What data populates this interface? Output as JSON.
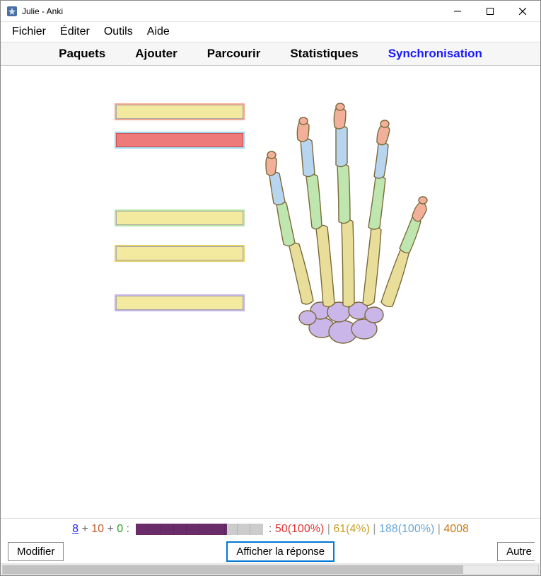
{
  "window": {
    "title": "Julie - Anki"
  },
  "menubar": {
    "items": [
      "Fichier",
      "Éditer",
      "Outils",
      "Aide"
    ]
  },
  "tabs": {
    "items": [
      {
        "label": "Paquets",
        "active": false
      },
      {
        "label": "Ajouter",
        "active": false
      },
      {
        "label": "Parcourir",
        "active": false
      },
      {
        "label": "Statistiques",
        "active": false
      },
      {
        "label": "Synchronisation",
        "active": false,
        "accent": true
      }
    ]
  },
  "card": {
    "labelGaps": [
      10,
      10,
      80,
      20,
      40
    ],
    "labelStyles": [
      "peach",
      "red",
      "green",
      "yellow",
      "purple"
    ]
  },
  "stats": {
    "new": "8",
    "plus1": "+",
    "learn": "10",
    "plus2": "+",
    "due": "0",
    "colon": ":",
    "progressPercent": 72,
    "segRedVal": "50",
    "segRedPct": "(100%)",
    "segYellowVal": "61",
    "segYellowPct": "(4%)",
    "segBlueVal": "188",
    "segBluePct": "(100%)",
    "segOrange": "4008",
    "pipe": "|"
  },
  "buttons": {
    "edit": "Modifier",
    "show": "Afficher la réponse",
    "moreCut": "Autre"
  },
  "scrollbar": {
    "thumbPercent": 86
  }
}
